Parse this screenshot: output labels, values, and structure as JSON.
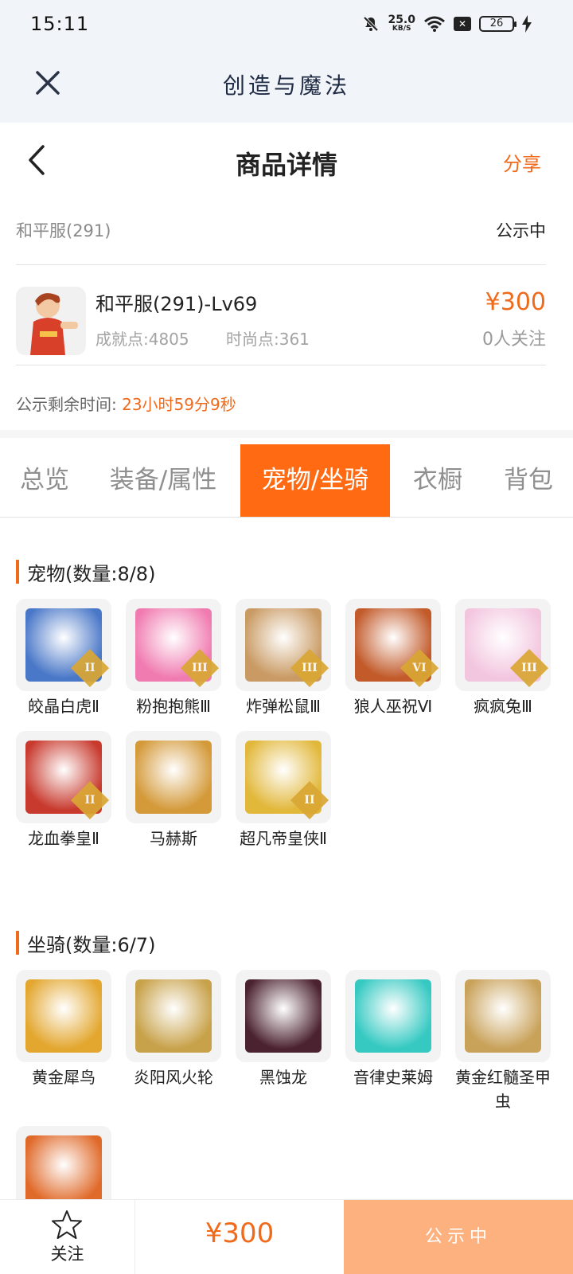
{
  "status_bar": {
    "time": "15:11",
    "net_speed": "25.0",
    "net_unit": "KB/S",
    "battery": "26"
  },
  "webview": {
    "title": "创造与魔法"
  },
  "header": {
    "title": "商品详情",
    "share": "分享"
  },
  "server": {
    "name": "和平服(291)",
    "status": "公示中"
  },
  "product": {
    "name": "和平服(291)-Lv69",
    "achievement": "成就点:4805",
    "fashion": "时尚点:361",
    "price": "¥300",
    "followers": "0人关注"
  },
  "countdown": {
    "label": "公示剩余时间:",
    "value": "23小时59分9秒"
  },
  "tabs": [
    "总览",
    "装备/属性",
    "宠物/坐骑",
    "衣橱",
    "背包"
  ],
  "pets": {
    "title": "宠物(数量:8/8)",
    "items": [
      {
        "name": "皎晶白虎Ⅱ",
        "rank": "II",
        "color": "#4a78c8"
      },
      {
        "name": "粉抱抱熊Ⅲ",
        "rank": "III",
        "color": "#f07bb0"
      },
      {
        "name": "炸弹松鼠Ⅲ",
        "rank": "III",
        "color": "#c99a63"
      },
      {
        "name": "狼人巫祝Ⅵ",
        "rank": "VI",
        "color": "#c25a2a"
      },
      {
        "name": "疯疯兔Ⅲ",
        "rank": "III",
        "color": "#f3c6df"
      },
      {
        "name": "龙血拳皇Ⅱ",
        "rank": "II",
        "color": "#c83a2e"
      },
      {
        "name": "马赫斯",
        "rank": "",
        "color": "#d49a3a"
      },
      {
        "name": "超凡帝皇侠Ⅱ",
        "rank": "II",
        "color": "#e2b83b"
      }
    ]
  },
  "mounts": {
    "title": "坐骑(数量:6/7)",
    "items": [
      {
        "name": "黄金犀鸟",
        "color": "#e3a72f"
      },
      {
        "name": "炎阳风火轮",
        "color": "#c8a24a"
      },
      {
        "name": "黑蚀龙",
        "color": "#4b2230"
      },
      {
        "name": "音律史莱姆",
        "color": "#35c9c2"
      },
      {
        "name": "黄金红髓圣甲虫",
        "color": "#c9a25a"
      },
      {
        "name": "",
        "color": "#e06a2a"
      }
    ]
  },
  "bottom": {
    "follow": "关注",
    "price": "¥300",
    "cta": "公示中"
  },
  "colors": {
    "accent": "#f06a1c",
    "tab_active": "#ff6a13",
    "cta": "#fdb17f"
  }
}
